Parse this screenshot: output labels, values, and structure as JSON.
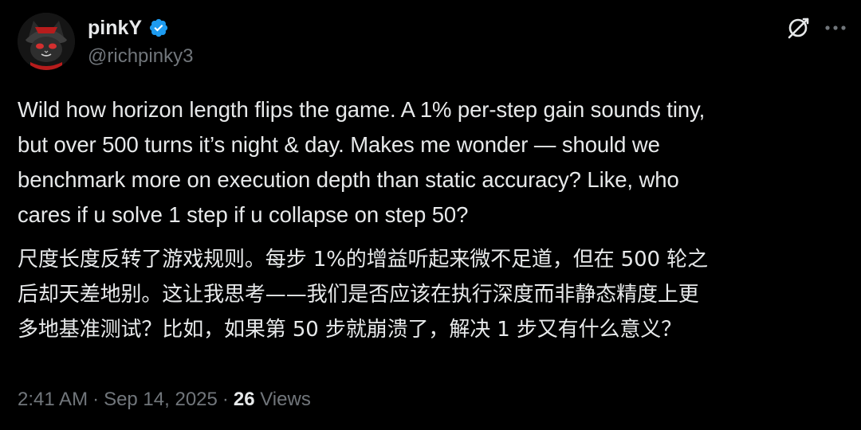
{
  "author": {
    "display_name": "pinkY",
    "handle": "@richpinky3",
    "verified": true,
    "verified_color": "#1d9bf0",
    "avatar_icon": "avatar-image"
  },
  "header_actions": {
    "grok_icon": "grok-icon",
    "more_icon": "more-icon"
  },
  "tweet": {
    "text_en": "Wild how horizon length flips the game. A 1% per-step gain sounds tiny,\nbut over 500 turns it’s night & day. Makes me wonder — should we\nbenchmark more on execution depth than static accuracy? Like, who\ncares if u solve 1 step if u collapse on step 50?",
    "text_zh": "尺度长度反转了游戏规则。每步 1%的增益听起来微不足道，但在 500 轮之\n后却天差地别。这让我思考——我们是否应该在执行深度而非静态精度上更\n多地基准测试？比如，如果第 50 步就崩溃了，解决 1 步又有什么意义？"
  },
  "meta": {
    "time": "2:41 AM",
    "date": "Sep 14, 2025",
    "separator": "·",
    "views_count": "26",
    "views_label": "Views"
  },
  "colors": {
    "background": "#000000",
    "primary_text": "#e7e9ea",
    "secondary_text": "#71767b",
    "accent": "#1d9bf0"
  }
}
